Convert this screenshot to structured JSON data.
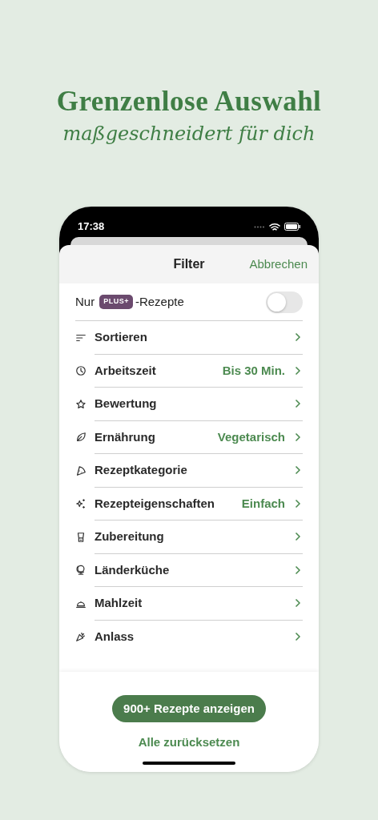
{
  "headline": {
    "title": "Grenzenlose Auswahl",
    "subtitle": "maßgeschneidert für dich"
  },
  "status_bar": {
    "time": "17:38"
  },
  "sheet": {
    "title": "Filter",
    "cancel": "Abbrechen"
  },
  "plus_toggle": {
    "prefix": "Nur",
    "badge": "PLUS+",
    "suffix": "-Rezepte",
    "on": false
  },
  "filters": [
    {
      "label": "Sortieren"
    },
    {
      "label": "Arbeitszeit",
      "value": "Bis 30 Min."
    },
    {
      "label": "Bewertung"
    },
    {
      "label": "Ernährung",
      "value": "Vegetarisch"
    },
    {
      "label": "Rezeptkategorie"
    },
    {
      "label": "Rezepteigenschaften",
      "value": "Einfach"
    },
    {
      "label": "Zubereitung"
    },
    {
      "label": "Länderküche"
    },
    {
      "label": "Mahlzeit"
    },
    {
      "label": "Anlass"
    }
  ],
  "footer": {
    "show_button": "900+ Rezepte anzeigen",
    "reset": "Alle zurücksetzen"
  }
}
